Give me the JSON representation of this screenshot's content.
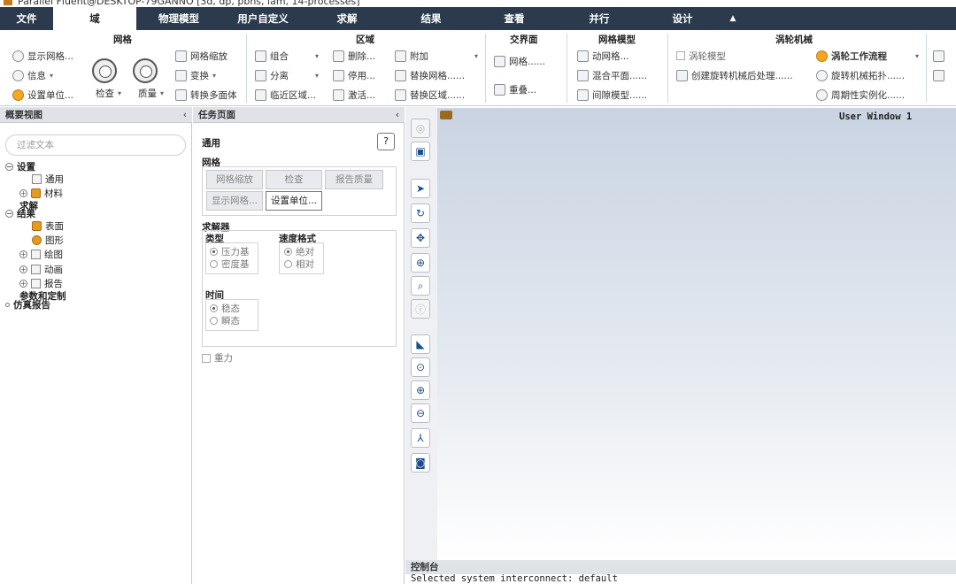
{
  "window": {
    "title": "Parallel Fluent@DESKTOP-79GANNO [3d, dp, pbns, lam, 14-processes]"
  },
  "menu": {
    "tabs": [
      "文件",
      "域",
      "物理模型",
      "用户自定义",
      "求解",
      "结果",
      "查看",
      "并行",
      "设计"
    ],
    "collapse": "▲",
    "active": 1
  },
  "ribbon": {
    "mesh": {
      "title": "网格",
      "display": "显示网格...",
      "info": "信息",
      "units": "设置单位...",
      "check": "检查",
      "quality": "质量",
      "scale": "网格缩放",
      "transform": "变换",
      "to_poly": "转换多面体"
    },
    "zones": {
      "title": "区域",
      "combine": "组合",
      "separate": "分离",
      "adjacency": "临近区域...",
      "delete": "删除...",
      "deactivate": "停用...",
      "activate": "激活...",
      "append": "附加",
      "replace_mesh": "替换网格......",
      "replace_zone": "替换区域......"
    },
    "interface": {
      "title": "交界面",
      "mesh": "网格......",
      "overlap": "重叠..."
    },
    "mesh_models": {
      "title": "网格模型",
      "dynamic": "动网格...",
      "mixing": "混合平面......",
      "gap": "间隙模型......"
    },
    "turbo": {
      "title": "涡轮机械",
      "model": "涡轮模型",
      "post": "创建旋转机械后处理......",
      "workflow": "涡轮工作流程",
      "topology": "旋转机械拓扑......",
      "periodic": "周期性实例化......"
    }
  },
  "outline": {
    "title": "概要视图",
    "collapse": "‹",
    "filter_placeholder": "过滤文本",
    "items": {
      "setup": "设置",
      "general": "通用",
      "materials": "材料",
      "solution": "求解",
      "results": "结果",
      "surfaces": "表面",
      "graphics": "图形",
      "plots": "绘图",
      "animations": "动画",
      "reports": "报告",
      "params": "参数和定制",
      "sim_reports": "仿真报告"
    }
  },
  "task": {
    "title": "任务页面",
    "collapse": "‹",
    "heading": "通用",
    "help": "?",
    "mesh_section": "网格",
    "btn_scale": "网格缩放",
    "btn_check": "检查",
    "btn_report_quality": "报告质量",
    "btn_display": "显示网格...",
    "btn_units": "设置单位...",
    "solver_section": "求解器",
    "type_label": "类型",
    "type_options": [
      "压力基",
      "密度基"
    ],
    "velocity_label": "速度格式",
    "velocity_options": [
      "绝对",
      "相对"
    ],
    "time_label": "时间",
    "time_options": [
      "稳态",
      "瞬态"
    ],
    "gravity": "重力"
  },
  "graphics": {
    "window_label": "User Window 1"
  },
  "console": {
    "title": "控制台",
    "line": "Selected system interconnect: default"
  }
}
